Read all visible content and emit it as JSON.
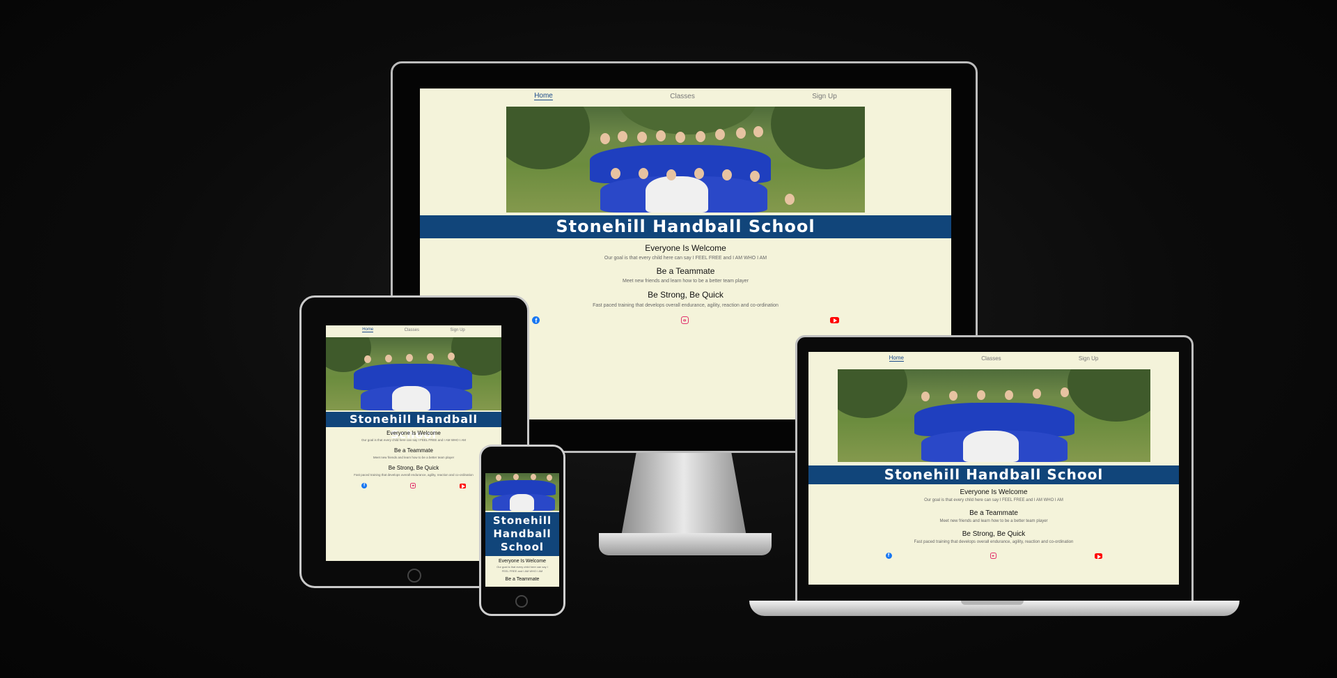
{
  "site": {
    "nav": [
      "Home",
      "Classes",
      "Sign Up"
    ],
    "title": "Stonehill Handball School",
    "title_lines": [
      "Stonehill",
      "Handball",
      "School"
    ],
    "sections": [
      {
        "heading": "Everyone Is Welcome",
        "text": "Our goal is that every child here can say I FEEL FREE and I AM WHO I AM"
      },
      {
        "heading": "Be a Teammate",
        "text": "Meet new friends and learn how to be a better team player"
      },
      {
        "heading": "Be Strong, Be Quick",
        "text": "Fast paced training that develops overall endurance, agility, reaction and co-ordination"
      }
    ],
    "phone_text": [
      "Our goal is that every child here can say I",
      "FEEL FREE and I AM WHO I AM"
    ],
    "phone_partial_heading": "Be a Teammate",
    "social": [
      "facebook-icon",
      "instagram-icon",
      "youtube-icon"
    ]
  },
  "colors": {
    "background": "#f4f3da",
    "banner": "#11457a",
    "nav_active": "#1a4a8a",
    "jersey": "#1f3fbf"
  }
}
